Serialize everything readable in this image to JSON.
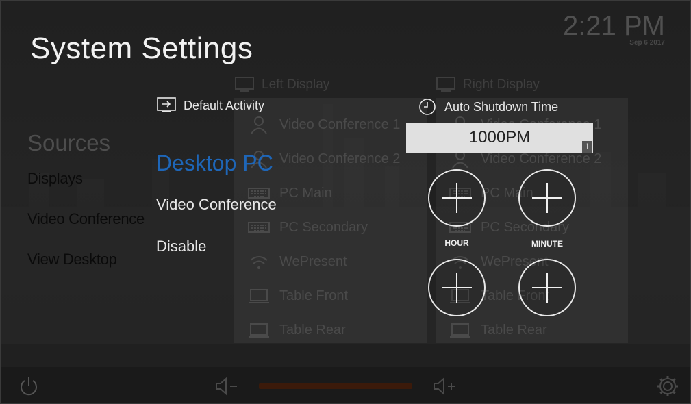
{
  "header": {
    "title": "System Settings",
    "clock_time": "2:21 PM",
    "clock_date": "Sep 6 2017"
  },
  "nav": {
    "section": "Sources",
    "items": [
      "Displays",
      "Video Conference",
      "View Desktop"
    ]
  },
  "panels": {
    "left_title": "Left Display",
    "right_title": "Right Display",
    "sources": [
      {
        "label": "Video Conference 1",
        "icon": "person-icon"
      },
      {
        "label": "Video Conference 2",
        "icon": "person-icon"
      },
      {
        "label": "PC Main",
        "icon": "keyboard-icon"
      },
      {
        "label": "PC Secondary",
        "icon": "keyboard-icon"
      },
      {
        "label": "WePresent",
        "icon": "wifi-icon"
      },
      {
        "label": "Table Front",
        "icon": "laptop-icon"
      },
      {
        "label": "Table Rear",
        "icon": "laptop-icon"
      }
    ]
  },
  "default_activity": {
    "title": "Default Activity",
    "options": [
      "Desktop PC",
      "Video Conference",
      "Disable"
    ],
    "selected": "Desktop PC"
  },
  "auto_shutdown": {
    "title": "Auto Shutdown Time",
    "value": "1000PM",
    "badge": "1",
    "hour_label": "HOUR",
    "minute_label": "MINUTE"
  },
  "colors": {
    "accent": "#1e66b8",
    "volume_track": "#3b1a0a"
  }
}
